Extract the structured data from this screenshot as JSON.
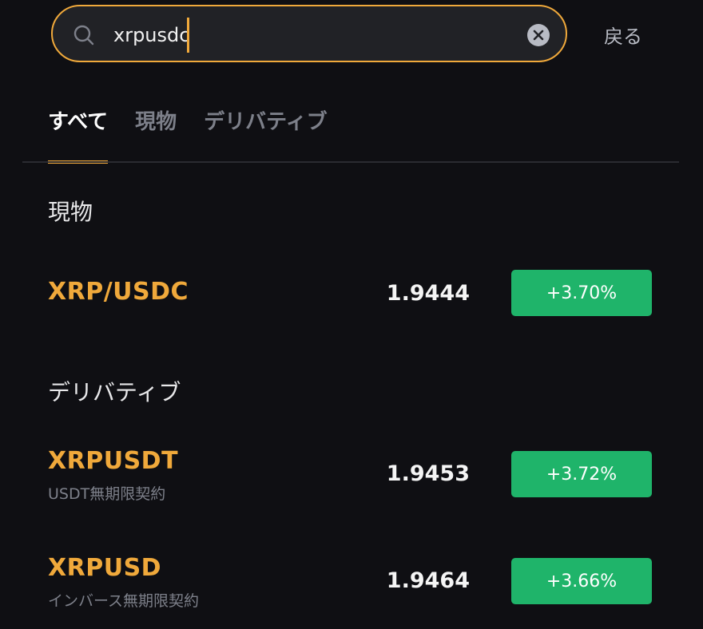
{
  "search": {
    "value": "xrpusdc",
    "back_label": "戻る"
  },
  "tabs": [
    {
      "label": "すべて",
      "active": true
    },
    {
      "label": "現物",
      "active": false
    },
    {
      "label": "デリバティブ",
      "active": false
    }
  ],
  "sections": {
    "spot": {
      "title": "現物",
      "items": [
        {
          "symbol": "XRP/USDC",
          "price": "1.9444",
          "change": "+3.70%"
        }
      ]
    },
    "derivatives": {
      "title": "デリバティブ",
      "items": [
        {
          "symbol": "XRPUSDT",
          "subtitle": "USDT無期限契約",
          "price": "1.9453",
          "change": "+3.72%"
        },
        {
          "symbol": "XRPUSD",
          "subtitle": "インバース無期限契約",
          "price": "1.9464",
          "change": "+3.66%"
        }
      ]
    }
  },
  "colors": {
    "accent": "#f0a93b",
    "positive": "#1fb46a",
    "background": "#0f0f13"
  },
  "icons": {
    "search": "search-icon",
    "clear": "clear-icon"
  }
}
